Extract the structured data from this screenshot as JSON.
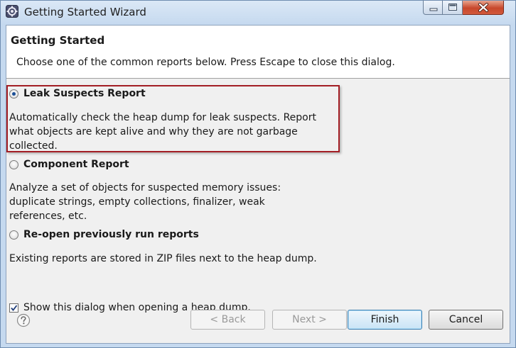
{
  "window": {
    "title": "Getting Started Wizard",
    "icons": {
      "app": "wizard-gear-icon",
      "minimize": "minimize-icon",
      "maximize": "maximize-icon",
      "close": "close-icon"
    }
  },
  "header": {
    "title": "Getting Started",
    "subtitle": "Choose one of the common reports below. Press Escape to close this dialog."
  },
  "options": [
    {
      "label": "Leak Suspects Report",
      "selected": true,
      "description": [
        "Automatically check the heap dump for leak suspects. Report",
        "what objects are kept alive and why they are not garbage",
        "collected."
      ]
    },
    {
      "label": "Component Report",
      "selected": false,
      "description": [
        "Analyze a set of objects for suspected memory issues:",
        "duplicate strings, empty collections, finalizer, weak",
        "references, etc."
      ]
    },
    {
      "label": "Re-open previously run reports",
      "selected": false,
      "description": [
        "Existing reports are stored in ZIP files next to the heap dump."
      ]
    }
  ],
  "show_dialog": {
    "label": "Show this dialog when opening a heap dump.",
    "checked": true
  },
  "footer": {
    "help_icon": "help-question-icon",
    "back_label": "< Back",
    "next_label": "Next >",
    "finish_label": "Finish",
    "cancel_label": "Cancel"
  },
  "colors": {
    "highlight_border": "#a31e24",
    "radio_dot": "#1b4f96",
    "close_button": "#c7472b"
  }
}
